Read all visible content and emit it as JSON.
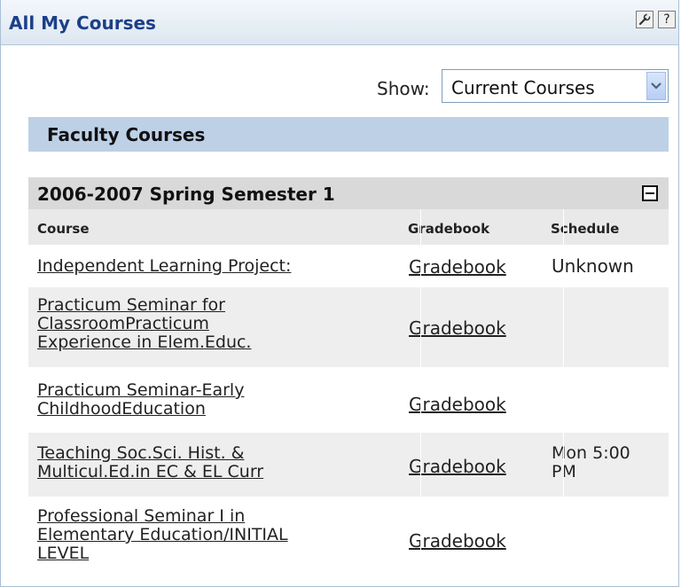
{
  "header": {
    "title": "All My Courses",
    "tools_icon": "wrench-icon",
    "help_label": "?"
  },
  "filter": {
    "label": "Show:",
    "selected": "Current Courses",
    "arrow_icon": "chevron-down-icon"
  },
  "section": {
    "title": "Faculty Courses"
  },
  "term": {
    "title": "2006-2007 Spring Semester 1",
    "collapse_icon": "minus-box-icon"
  },
  "columns": {
    "course": "Course",
    "gradebook": "Gradebook",
    "schedule": "Schedule"
  },
  "rows": [
    {
      "course_lines": [
        "Independent Learning Project:"
      ],
      "gradebook": "Gradebook",
      "schedule_lines": [
        "Unknown"
      ]
    },
    {
      "course_lines": [
        "Practicum Seminar for",
        "ClassroomPracticum",
        "Experience in Elem.Educ."
      ],
      "gradebook": "Gradebook",
      "schedule_lines": []
    },
    {
      "course_lines": [
        "Practicum Seminar-Early",
        "ChildhoodEducation"
      ],
      "gradebook": "Gradebook",
      "schedule_lines": []
    },
    {
      "course_lines": [
        "Teaching Soc.Sci. Hist. &",
        "Multicul.Ed.in EC & EL Curr"
      ],
      "gradebook": "Gradebook",
      "schedule_lines": [
        "Mon 5:00",
        "PM"
      ]
    },
    {
      "course_lines": [
        "Professional Seminar I in",
        "Elementary Education/INITIAL",
        "LEVEL"
      ],
      "gradebook": "Gradebook",
      "schedule_lines": []
    }
  ],
  "colors": {
    "title_text": "#1c3f88",
    "section_bg": "#bdd0e6",
    "term_bg": "#d9d9d9",
    "alt_row_bg": "#eeeeee"
  }
}
